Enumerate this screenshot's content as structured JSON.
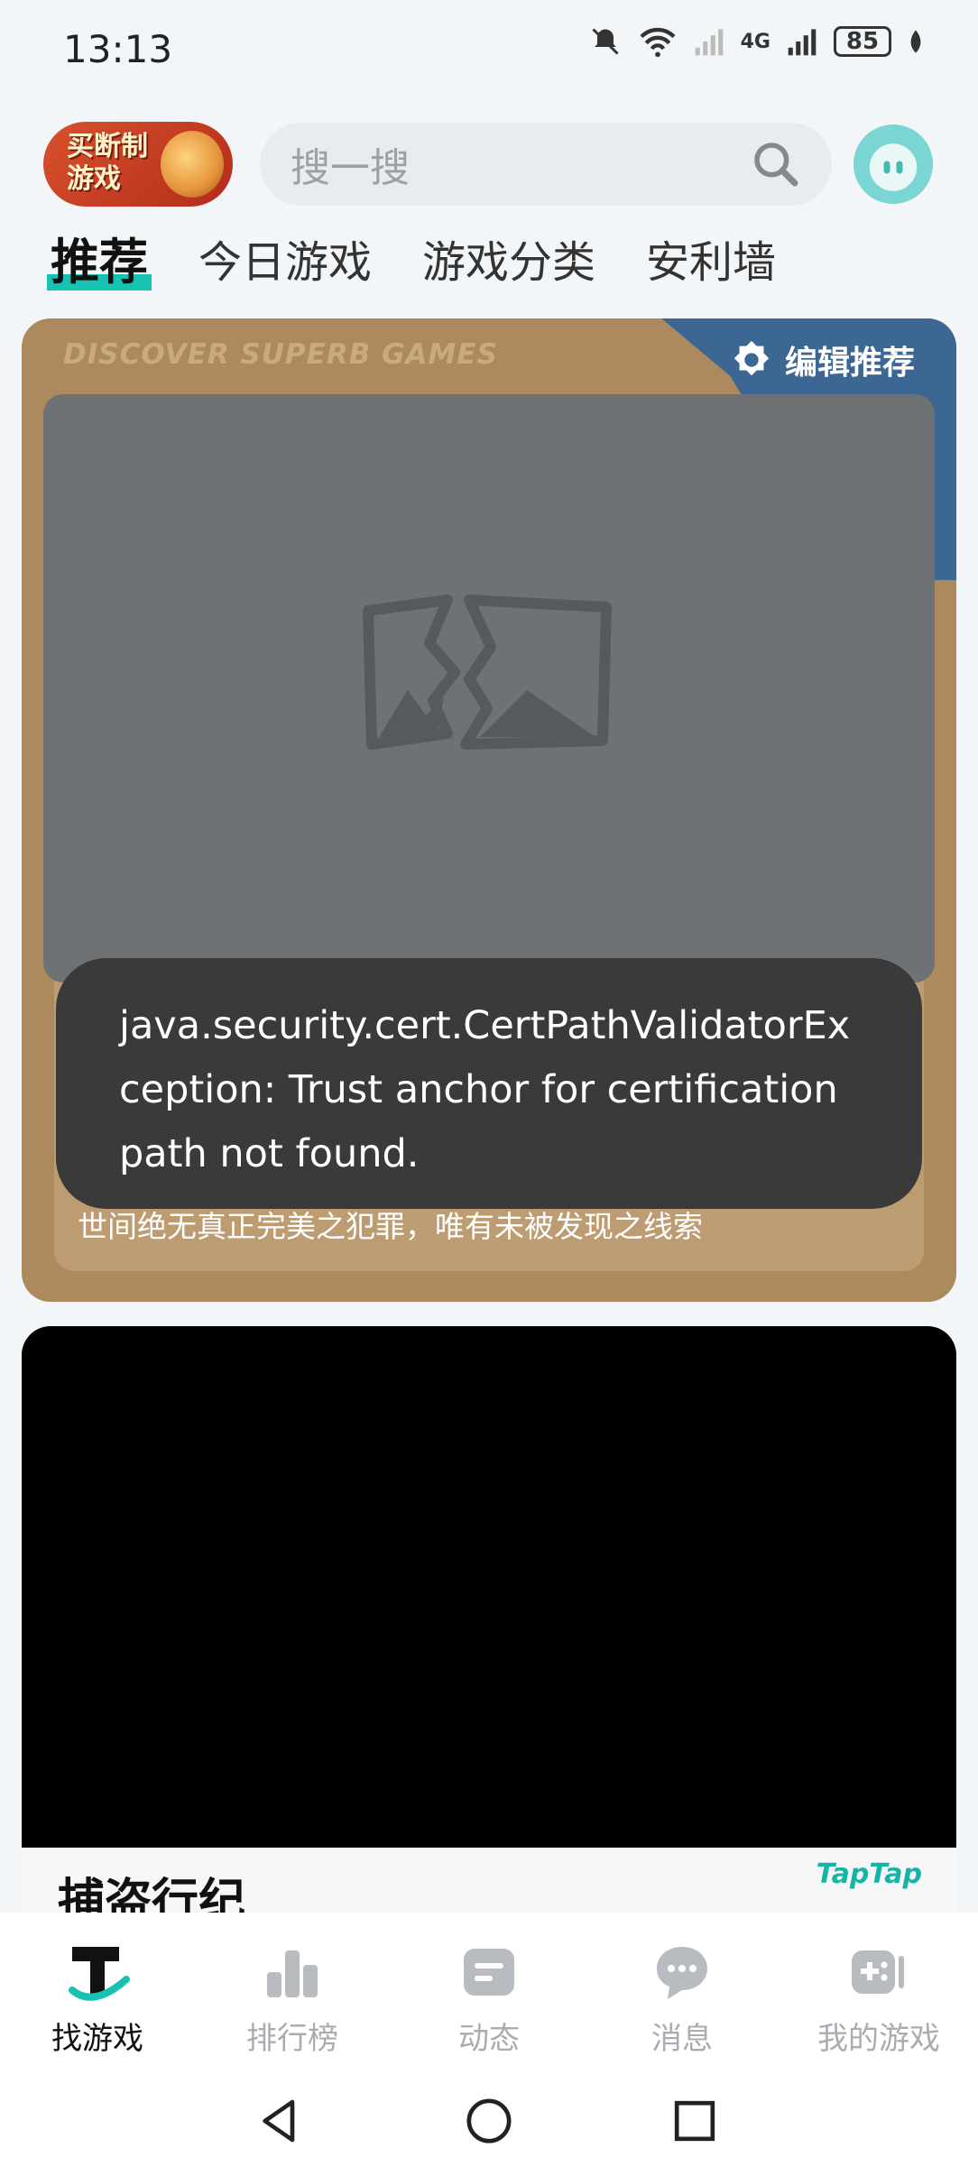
{
  "status_bar": {
    "time": "13:13",
    "battery": "85",
    "network": "4G"
  },
  "header": {
    "promo_text": "买断制游戏",
    "search_placeholder": "搜一搜"
  },
  "tabs": [
    {
      "label": "推荐",
      "active": true
    },
    {
      "label": "今日游戏",
      "active": false
    },
    {
      "label": "游戏分类",
      "active": false
    },
    {
      "label": "安利墙",
      "active": false
    }
  ],
  "featured_card": {
    "banner": "DISCOVER SUPERB GAMES",
    "editor_label": "编辑推荐",
    "tagline": "世间绝无真正完美之犯罪，唯有未被发现之线索"
  },
  "toast": {
    "message": "java.security.cert.CertPathValidatorException: Trust anchor for certification path not found."
  },
  "second_card": {
    "title": "捕盗行纪",
    "rating_source": "TapTap"
  },
  "bottom_nav": [
    {
      "label": "找游戏",
      "icon": "find-game-icon",
      "active": true
    },
    {
      "label": "排行榜",
      "icon": "ranking-icon",
      "active": false
    },
    {
      "label": "动态",
      "icon": "feed-icon",
      "active": false
    },
    {
      "label": "消息",
      "icon": "message-icon",
      "active": false
    },
    {
      "label": "我的游戏",
      "icon": "my-games-icon",
      "active": false
    }
  ],
  "colors": {
    "accent": "#18c2b2",
    "card_bg": "#ad8a5d",
    "editor_bg": "#3d6793",
    "toast_bg": "#3a3a3a"
  }
}
